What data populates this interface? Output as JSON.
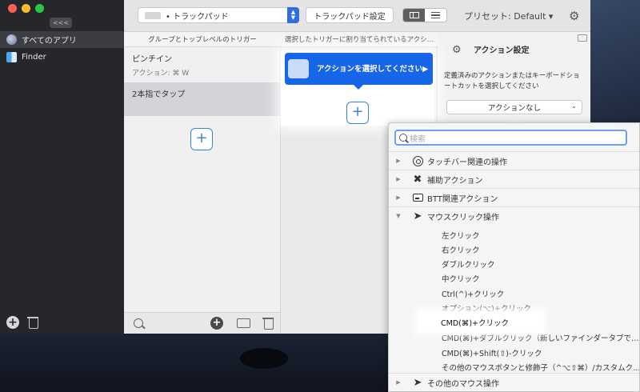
{
  "sidebar": {
    "collapse_label": "<<<",
    "items": [
      {
        "label": "すべてのアプリ",
        "icon": "globe-icon"
      },
      {
        "label": "Finder",
        "icon": "finder-icon"
      }
    ]
  },
  "toolbar": {
    "device_popup": "• トラックパッド",
    "settings_button": "トラックパッド設定",
    "preset_label": "プリセット: Default ▾"
  },
  "columns": {
    "col1_header": "グループとトップレベルのトリガー",
    "col2_header": "選択したトリガーに割り当てられているアクシ…"
  },
  "triggers": [
    {
      "label": "ピンチイン",
      "sub": "アクション: ⌘ W"
    },
    {
      "label": "2本指でタップ",
      "sub": ""
    }
  ],
  "action_card": {
    "text": "アクションを選択してください▶"
  },
  "settings_panel": {
    "title": "アクション設定",
    "description": "定義済みのアクションまたはキーボードショートカットを選択してください",
    "dropdown_value": "アクションなし"
  },
  "menu": {
    "search_placeholder": "検索",
    "categories": [
      {
        "label": "タッチバー関連の操作",
        "expanded": false
      },
      {
        "label": "補助アクション",
        "expanded": false
      },
      {
        "label": "BTT関連アクション",
        "expanded": false
      },
      {
        "label": "マウスクリック操作",
        "expanded": true
      }
    ],
    "sub_items": [
      "左クリック",
      "右クリック",
      "ダブルクリック",
      "中クリック",
      "Ctrl(^)+クリック",
      "オプション(⌥)+クリック",
      "CMD(⌘)+クリック",
      "CMD(⌘)+ダブルクリック（新しいファインダータブで…",
      "CMD(⌘)+Shift(⇧)-クリック",
      "その他のマウスボタンと修飾子（^⌥⇧⌘）/カスタムク…"
    ],
    "last_category": "その他のマウス操作"
  }
}
